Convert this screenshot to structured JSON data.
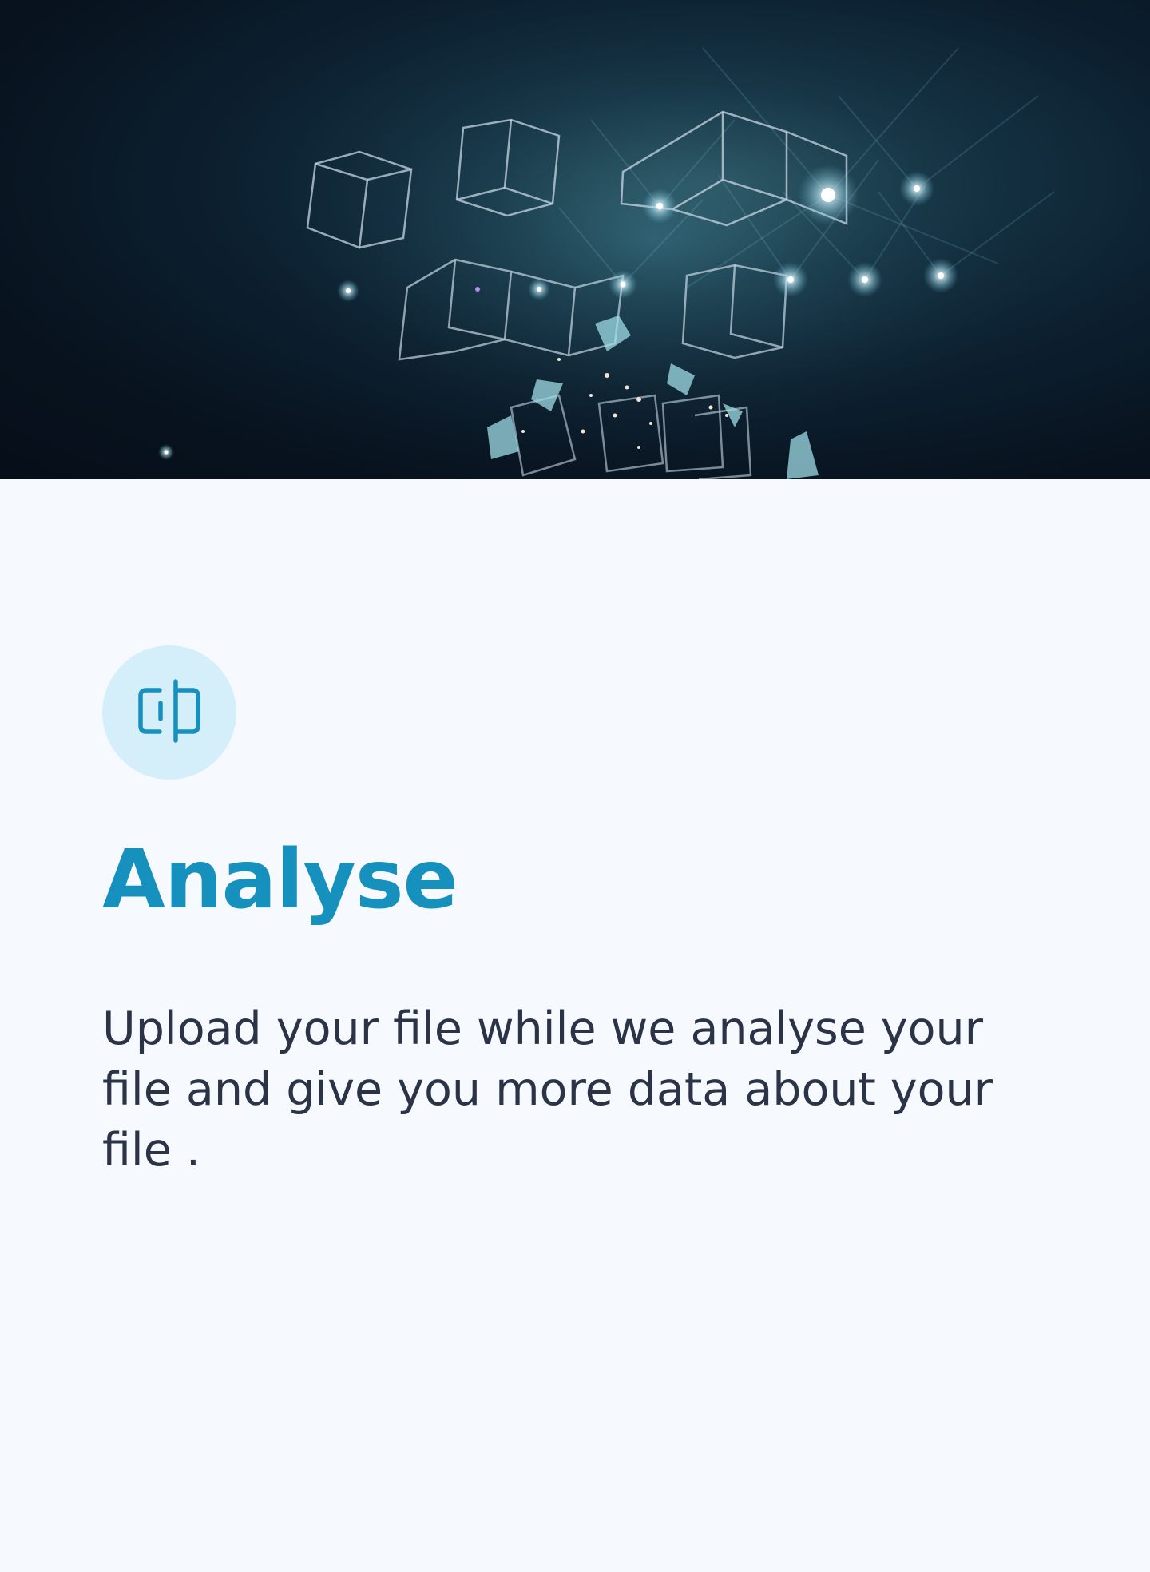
{
  "hero": {
    "image": "abstract-glowing-cubes-stage-lights"
  },
  "feature": {
    "icon": "split-view-icon",
    "title": "Analyse",
    "description": "Upload your file while we analyse your file and give you more data about your file ."
  },
  "colors": {
    "page_background": "#f6f9fe",
    "accent": "#1690bd",
    "icon_circle": "#d4effa",
    "body_text": "#2b3346"
  }
}
